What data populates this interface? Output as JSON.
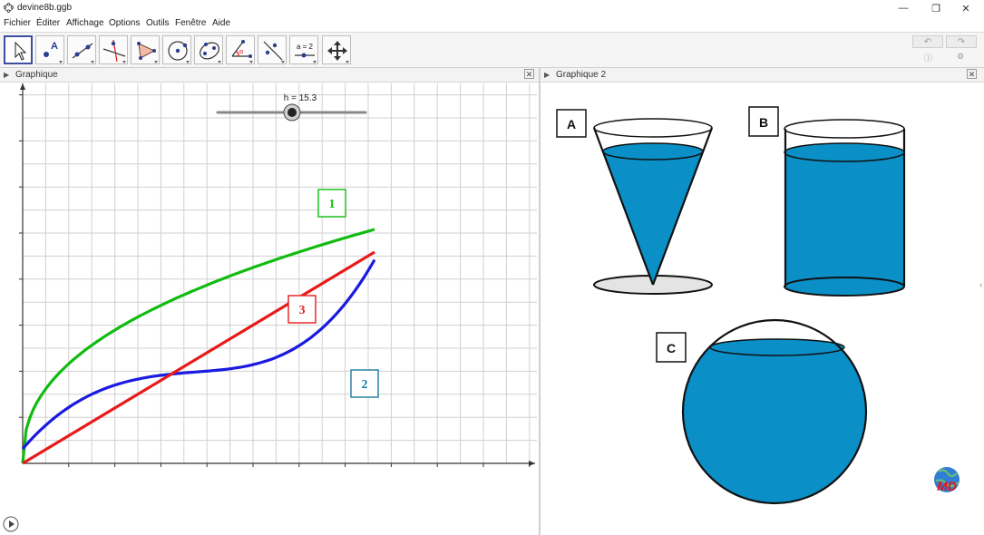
{
  "window": {
    "title": "devine8b.ggb",
    "minimize_icon": "minimize-icon",
    "maximize_icon": "restore-icon",
    "close_icon": "close-icon"
  },
  "menu": [
    "Fichier",
    "Éditer",
    "Affichage",
    "Options",
    "Outils",
    "Fenêtre",
    "Aide"
  ],
  "toolbar": {
    "tools": [
      "move-tool-icon",
      "point-tool-icon",
      "line-tool-icon",
      "perpendicular-tool-icon",
      "polygon-tool-icon",
      "circle-tool-icon",
      "ellipse-tool-icon",
      "angle-tool-icon",
      "reflect-tool-icon",
      "slider-tool-icon",
      "move-view-tool-icon"
    ],
    "slider_tool_label": "a = 2",
    "undo_icon": "undo-icon",
    "redo_icon": "redo-icon",
    "help_icon": "help-icon",
    "settings_icon": "gear-icon"
  },
  "graphics1": {
    "title": "Graphique",
    "slider_label": "h = 15.3",
    "slider_value": 15.3,
    "labels": {
      "green": "1",
      "blue": "2",
      "red": "3"
    },
    "colors": {
      "green": "#11bb11",
      "red": "#e81b1b",
      "blue": "#1a1ae0",
      "grid": "#cfcfcf"
    }
  },
  "graphics2": {
    "title": "Graphique 2",
    "labels": {
      "cone": "A",
      "cylinder": "B",
      "sphere": "C"
    },
    "water_color": "#0a8fc6",
    "logo_text": "MD"
  },
  "play_icon": "play-icon"
}
